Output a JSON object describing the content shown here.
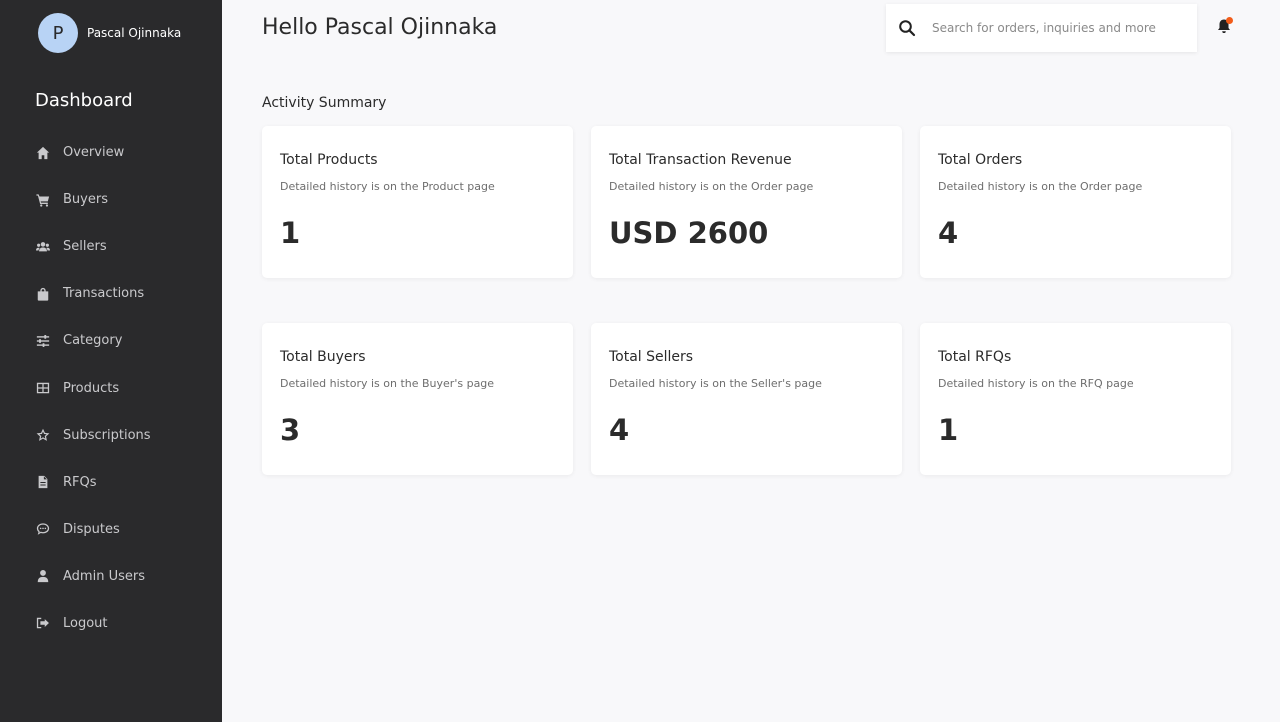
{
  "user": {
    "initial": "P",
    "name": "Pascal Ojinnaka"
  },
  "sidebar": {
    "title": "Dashboard",
    "items": [
      {
        "label": "Overview",
        "icon": "home-icon"
      },
      {
        "label": "Buyers",
        "icon": "cart-icon"
      },
      {
        "label": "Sellers",
        "icon": "users-icon"
      },
      {
        "label": "Transactions",
        "icon": "bag-icon"
      },
      {
        "label": "Category",
        "icon": "sliders-icon"
      },
      {
        "label": "Products",
        "icon": "grid-icon"
      },
      {
        "label": "Subscriptions",
        "icon": "star-icon"
      },
      {
        "label": "RFQs",
        "icon": "file-icon"
      },
      {
        "label": "Disputes",
        "icon": "chat-icon"
      },
      {
        "label": "Admin Users",
        "icon": "user-icon"
      },
      {
        "label": "Logout",
        "icon": "logout-icon"
      }
    ]
  },
  "header": {
    "greeting": "Hello Pascal Ojinnaka",
    "search_placeholder": "Search for orders, inquiries and more",
    "notification_dot_color": "#f25c19"
  },
  "summary": {
    "title": "Activity Summary",
    "cards": [
      {
        "title": "Total Products",
        "desc": "Detailed history is on the Product page",
        "value": "1"
      },
      {
        "title": "Total Transaction Revenue",
        "desc": "Detailed history is on the Order page",
        "value": "USD 2600"
      },
      {
        "title": "Total Orders",
        "desc": "Detailed history is on the Order page",
        "value": "4"
      },
      {
        "title": "Total Buyers",
        "desc": "Detailed history is on the Buyer's page",
        "value": "3"
      },
      {
        "title": "Total Sellers",
        "desc": "Detailed history is on the Seller's page",
        "value": "4"
      },
      {
        "title": "Total RFQs",
        "desc": "Detailed history is on the RFQ page",
        "value": "1"
      }
    ]
  }
}
